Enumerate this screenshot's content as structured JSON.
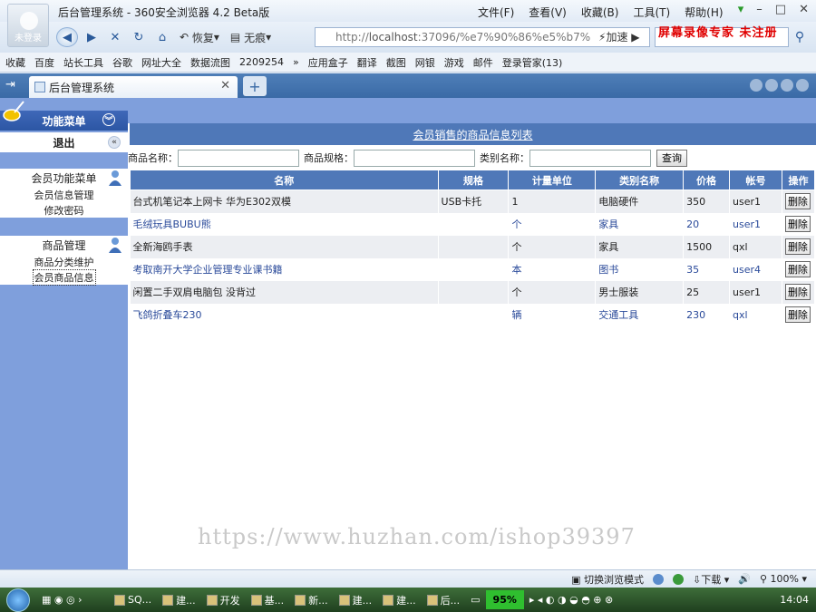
{
  "window": {
    "title": "后台管理系统 - 360安全浏览器 4.2 Beta版",
    "avatar_label": "未登录",
    "menu": [
      "文件(F)",
      "查看(V)",
      "收藏(B)",
      "工具(T)",
      "帮助(H)"
    ],
    "controls": [
      "▾",
      "–",
      "□",
      "✕"
    ]
  },
  "nav": {
    "restore_label": "恢复",
    "mode_label": "无痕",
    "url_prefix": "http://",
    "url_host": "localhost",
    "url_rest": ":37096/%e7%90%86%e5%b7%",
    "accel_label": "加速",
    "watermark_text": "屏幕录像专家 未注册"
  },
  "bookmarks": [
    "收藏",
    "百度",
    "站长工具",
    "谷歌",
    "网址大全",
    "数据流图",
    "2209254",
    "»",
    "应用盒子",
    "翻译",
    "截图",
    "网银",
    "游戏",
    "邮件",
    "登录管家(13)"
  ],
  "tabs": {
    "active_tab": "后台管理系统",
    "new_tab": "+"
  },
  "sidebar": {
    "header": "功能菜单",
    "logout": "退出",
    "groups": [
      {
        "title": "会员功能菜单",
        "items": [
          "会员信息管理",
          "修改密码"
        ]
      },
      {
        "title": "商品管理",
        "items": [
          "商品分类维护",
          "会员商品信息"
        ]
      }
    ]
  },
  "main": {
    "title": "会员销售的商品信息列表",
    "search": {
      "name_label": "商品名称：",
      "spec_label": "商品规格：",
      "category_label": "类别名称：",
      "query_button": "查询"
    },
    "columns": [
      "名称",
      "规格",
      "计量单位",
      "类别名称",
      "价格",
      "帐号",
      "操作"
    ],
    "rows": [
      {
        "name": "台式机笔记本上网卡 华为E302双模",
        "spec": "USB卡托",
        "unit": "1",
        "category": "电脑硬件",
        "price": "350",
        "account": "user1",
        "action": "删除"
      },
      {
        "name": "毛绒玩具BUBU熊",
        "spec": "",
        "unit": "个",
        "category": "家具",
        "price": "20",
        "account": "user1",
        "action": "删除"
      },
      {
        "name": "全新海鸥手表",
        "spec": "",
        "unit": "个",
        "category": "家具",
        "price": "1500",
        "account": "qxl",
        "action": "删除"
      },
      {
        "name": "考取南开大学企业管理专业课书籍",
        "spec": "",
        "unit": "本",
        "category": "图书",
        "price": "35",
        "account": "user4",
        "action": "删除"
      },
      {
        "name": "闲置二手双肩电脑包 没背过",
        "spec": "",
        "unit": "个",
        "category": "男士服装",
        "price": "25",
        "account": "user1",
        "action": "删除"
      },
      {
        "name": "飞鸽折叠车230",
        "spec": "",
        "unit": "辆",
        "category": "交通工具",
        "price": "230",
        "account": "qxl",
        "action": "删除"
      }
    ],
    "watermark": "https://www.huzhan.com/ishop39397"
  },
  "statusbar": {
    "switch_mode": "切换浏览模式",
    "download": "下载",
    "zoom": "100%"
  },
  "taskbar": {
    "tasks": [
      "SQ...",
      "建...",
      "开发",
      "基...",
      "新...",
      "建...",
      "建...",
      "后..."
    ],
    "cpu": "95%",
    "clock": "14:04"
  }
}
